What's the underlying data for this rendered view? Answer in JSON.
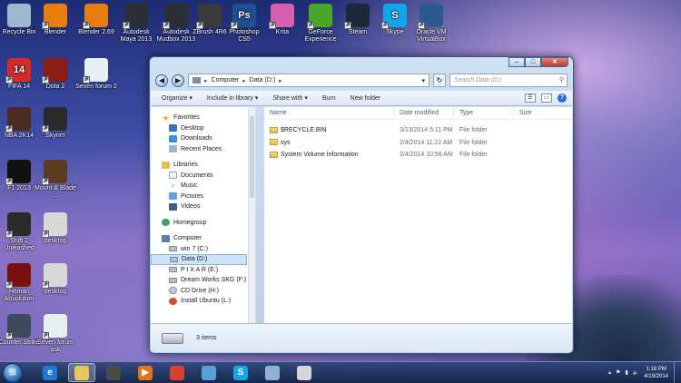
{
  "desktop": {
    "icons": [
      {
        "label": "Recycle Bin",
        "icon": "recycle-bin-icon",
        "color": "#9fb6cf"
      },
      {
        "label": "Blender",
        "icon": "blender-icon",
        "color": "#e87d0d"
      },
      {
        "label": "Blender 2.69",
        "icon": "blender-icon",
        "color": "#e87d0d"
      },
      {
        "label": "Autodesk Maya 2013",
        "icon": "maya-icon",
        "color": "#2b2f34"
      },
      {
        "label": "Autodesk Mudbox 2013",
        "icon": "mudbox-icon",
        "color": "#2b2f34"
      },
      {
        "label": "ZBrush 4R6",
        "icon": "zbrush-icon",
        "color": "#3a3a3a"
      },
      {
        "label": "Photoshop CS5",
        "icon": "photoshop-icon",
        "color": "#1d4f91",
        "glyph": "Ps"
      },
      {
        "label": "Krita",
        "icon": "krita-icon",
        "color": "#d65fb0"
      },
      {
        "label": "GeForce Experience",
        "icon": "geforce-icon",
        "color": "#4aa629"
      },
      {
        "label": "Steam",
        "icon": "steam-icon",
        "color": "#1b2838"
      },
      {
        "label": "Skype",
        "icon": "skype-icon",
        "color": "#12a5e8",
        "glyph": "S"
      },
      {
        "label": "Oracle VM VirtualBox",
        "icon": "virtualbox-icon",
        "color": "#2d5a8e"
      },
      {
        "label": "FIFA 14",
        "icon": "fifa-icon",
        "color": "#d32a2a",
        "glyph": "14"
      },
      {
        "label": "Dota 2",
        "icon": "dota-icon",
        "color": "#8c1c13"
      },
      {
        "label": "Seven forum 2",
        "icon": "seven-forum-icon",
        "color": "#e9eef5"
      },
      {
        "label": "NBA 2K14",
        "icon": "nba-icon",
        "color": "#4b2a20"
      },
      {
        "label": "Skyrim",
        "icon": "skyrim-icon",
        "color": "#2a2a2a"
      },
      {
        "label": "F1 2013",
        "icon": "f1-icon",
        "color": "#111111"
      },
      {
        "label": "Mount & Blade ...",
        "icon": "mount-blade-icon",
        "color": "#5c3b22"
      },
      {
        "label": "Shift 2 Unleashed",
        "icon": "shift-icon",
        "color": "#2a2a2a"
      },
      {
        "label": "desktop",
        "icon": "desktop-shortcut-icon",
        "color": "#d8d8d8"
      },
      {
        "label": "Hitman Absolution",
        "icon": "hitman-icon",
        "color": "#7a1010"
      },
      {
        "label": "desktop",
        "icon": "desktop-shortcut-icon",
        "color": "#d8d8d8"
      },
      {
        "label": "Counter Strike",
        "icon": "counter-strike-icon",
        "color": "#3d4a5a"
      },
      {
        "label": "Seven forum ask",
        "icon": "seven-forum-icon",
        "color": "#e9eef5"
      }
    ]
  },
  "window": {
    "address": [
      "Computer",
      "Data (D:)"
    ],
    "search_placeholder": "Search Data (D:)",
    "toolbar": {
      "organize": "Organize",
      "include": "Include in library",
      "share": "Share with",
      "burn": "Burn",
      "new_folder": "New folder"
    },
    "nav": {
      "favorites": {
        "title": "Favorites",
        "items": [
          "Desktop",
          "Downloads",
          "Recent Places"
        ]
      },
      "libraries": {
        "title": "Libraries",
        "items": [
          "Documents",
          "Music",
          "Pictures",
          "Videos"
        ]
      },
      "homegroup": "Homegroup",
      "computer": {
        "title": "Computer",
        "items": [
          "win 7 (C:)",
          "Data (D:)",
          "P I X A R (E:)",
          "Dream Works SKG (F:)",
          "CD Drive (H:)",
          "Install Ubuntu (L:)"
        ]
      }
    },
    "columns": {
      "name": "Name",
      "date": "Date modified",
      "type": "Type",
      "size": "Size"
    },
    "files": [
      {
        "name": "$RECYCLE.BIN",
        "date": "3/13/2014 5:11 PM",
        "type": "File folder"
      },
      {
        "name": "sys",
        "date": "2/4/2014 11:22 AM",
        "type": "File folder"
      },
      {
        "name": "System Volume Information",
        "date": "2/4/2014 10:56 AM",
        "type": "File folder"
      }
    ],
    "status": "3 items"
  },
  "taskbar": {
    "apps": [
      {
        "icon": "internet-explorer-icon",
        "glyph": "e",
        "color": "#1e78d6",
        "active": false
      },
      {
        "icon": "file-explorer-icon",
        "glyph": "",
        "color": "#e7c65b",
        "active": true
      },
      {
        "icon": "media-app-icon",
        "glyph": "",
        "color": "#4a4a4a",
        "active": false
      },
      {
        "icon": "media-player-icon",
        "glyph": "▶",
        "color": "#e0741c",
        "active": false
      },
      {
        "icon": "chrome-icon",
        "glyph": "",
        "color": "#d9412f",
        "active": false
      },
      {
        "icon": "writing-app-icon",
        "glyph": "",
        "color": "#5aa0d8",
        "active": false
      },
      {
        "icon": "skype-icon",
        "glyph": "S",
        "color": "#12a5e8",
        "active": false
      },
      {
        "icon": "tool-app-icon",
        "glyph": "",
        "color": "#8fb2d2",
        "active": false
      },
      {
        "icon": "paint-app-icon",
        "glyph": "",
        "color": "#d6d6d6",
        "active": false
      }
    ],
    "time": "1:18 PM",
    "date": "4/19/2014"
  }
}
